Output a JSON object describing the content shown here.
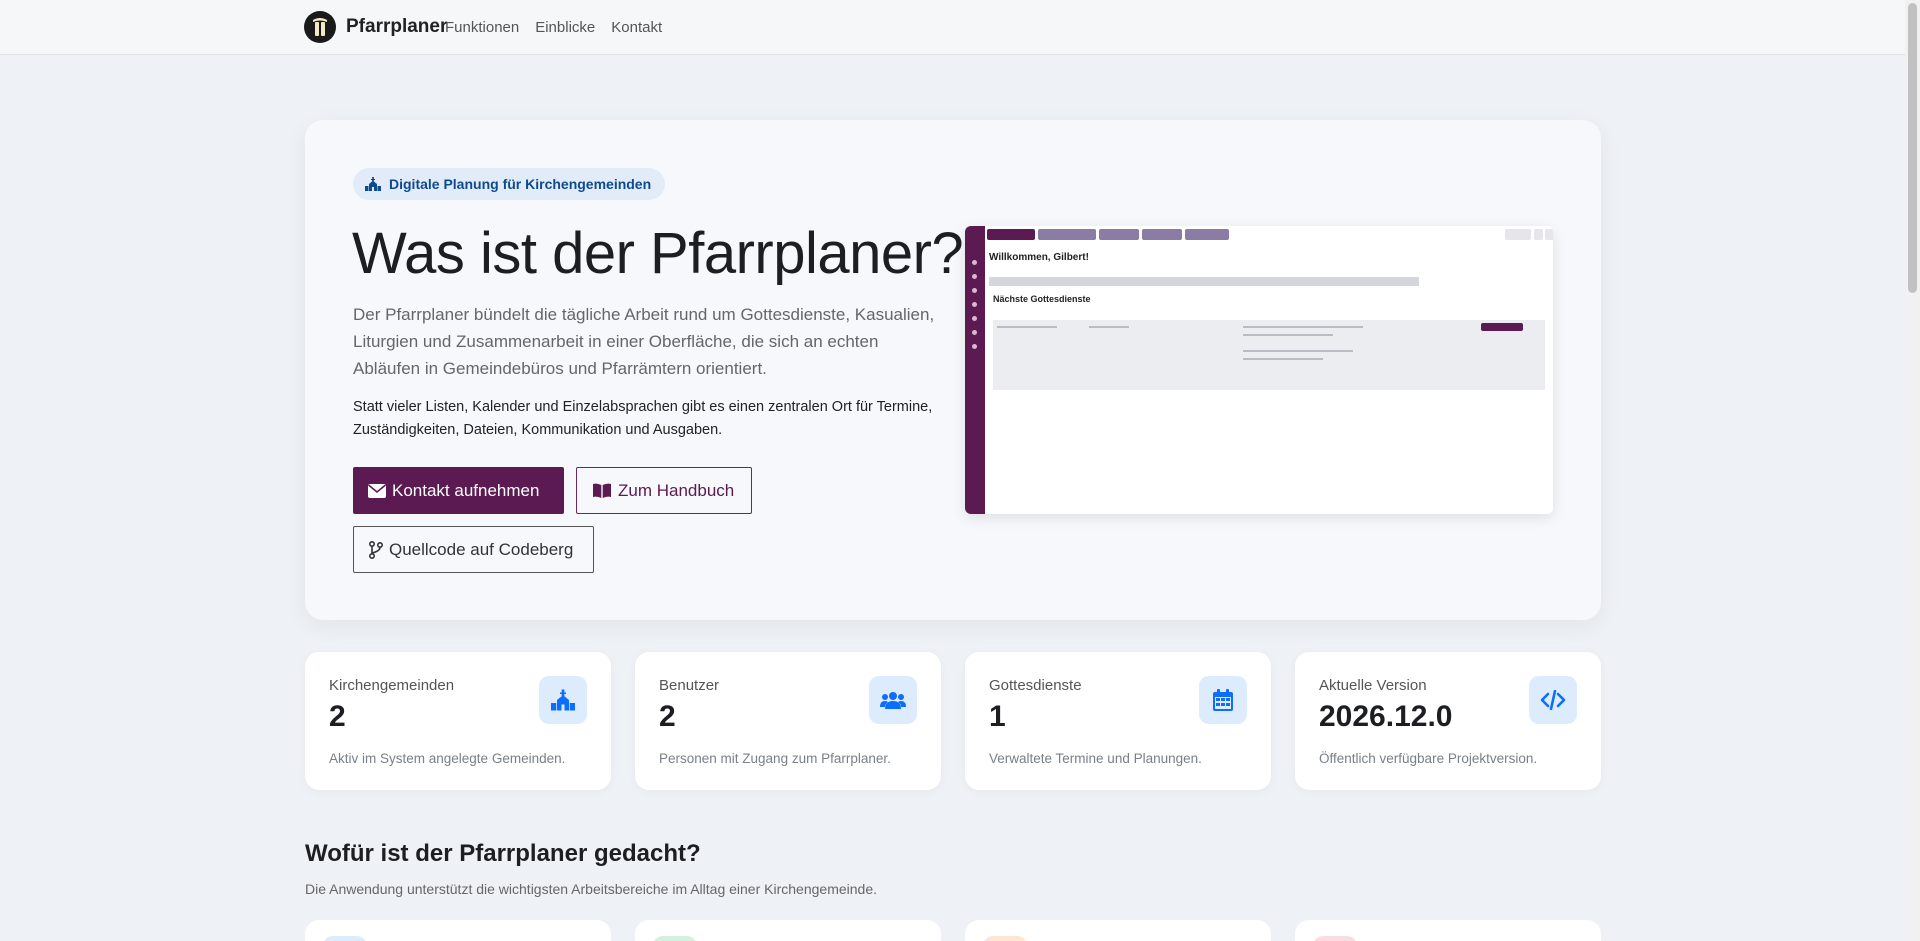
{
  "nav": {
    "brand": "Pfarrplaner",
    "links": [
      "Funktionen",
      "Einblicke",
      "Kontakt"
    ]
  },
  "hero": {
    "badge": "Digitale Planung für Kirchengemeinden",
    "title": "Was ist der Pfarrplaner?",
    "lead": "Der Pfarrplaner bündelt die tägliche Arbeit rund um Gottesdienste, Kasualien, Liturgien und Zusammenarbeit in einer Oberfläche, die sich an echten Abläufen in Gemeindebüros und Pfarrämtern orientiert.",
    "text": "Statt vieler Listen, Kalender und Einzelabsprachen gibt es einen zentralen Ort für Termine, Zuständigkeiten, Dateien, Kommunikation und Ausgaben.",
    "btn_contact": "Kontakt aufnehmen",
    "btn_manual": "Zum Handbuch",
    "btn_source": "Quellcode auf Codeberg"
  },
  "preview": {
    "welcome": "Willkommen, Gilbert!",
    "heading": "Nächste Gottesdienste"
  },
  "stats": [
    {
      "label": "Kirchengemeinden",
      "value": "2",
      "desc": "Aktiv im System angelegte Gemeinden.",
      "icon": "church-icon"
    },
    {
      "label": "Benutzer",
      "value": "2",
      "desc": "Personen mit Zugang zum Pfarrplaner.",
      "icon": "users-icon"
    },
    {
      "label": "Gottesdienste",
      "value": "1",
      "desc": "Verwaltete Termine und Planungen.",
      "icon": "calendar-icon"
    },
    {
      "label": "Aktuelle Version",
      "value": "2026.12.0",
      "desc": "Öffentlich verfügbare Projektversion.",
      "icon": "code-icon"
    }
  ],
  "section": {
    "title": "Wofür ist der Pfarrplaner gedacht?",
    "subtitle": "Die Anwendung unterstützt die wichtigsten Arbeitsbereiche im Alltag einer Kirchengemeinde."
  },
  "colors": {
    "primary": "#5b1a52",
    "accent_blue": "#0d6efd",
    "icon_bg": "#dcecfd",
    "page_bg": "#eef1f6"
  }
}
